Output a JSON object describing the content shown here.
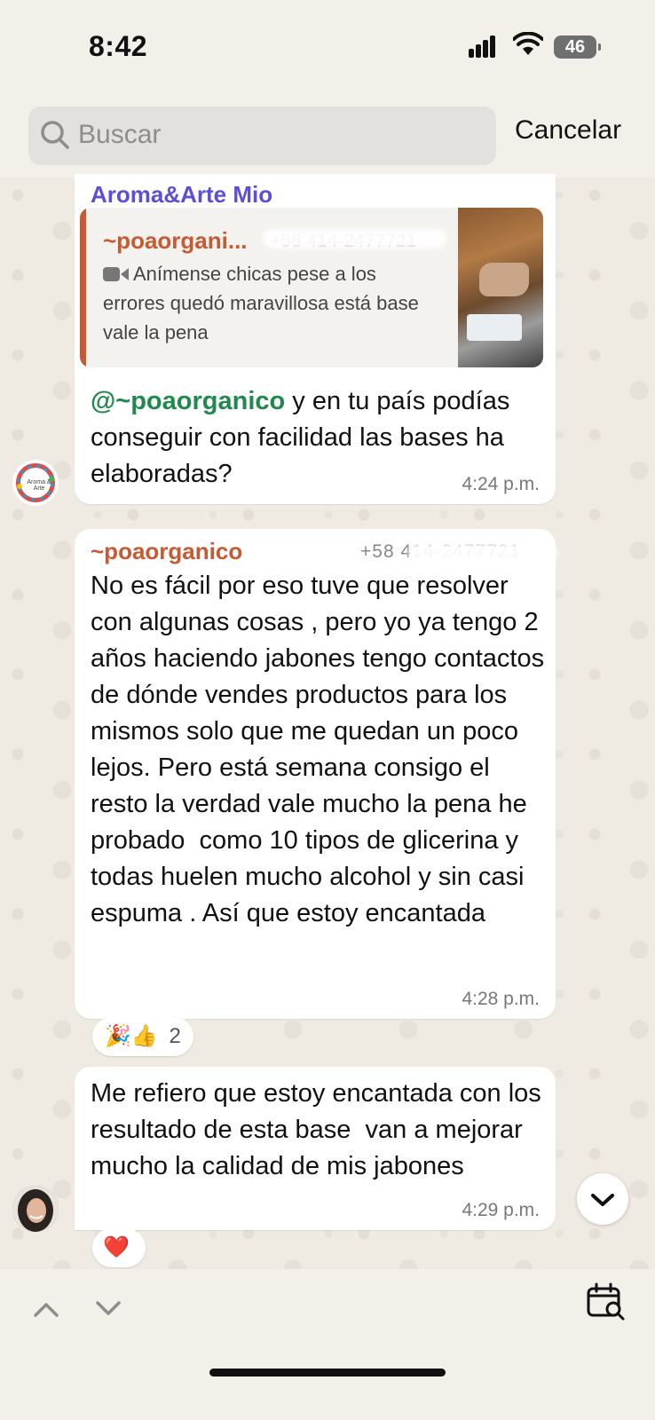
{
  "status_bar": {
    "time": "8:42",
    "battery": "46"
  },
  "search": {
    "placeholder": "Buscar",
    "value": "",
    "cancel_label": "Cancelar"
  },
  "messages": [
    {
      "sender": "Aroma&Arte Mio",
      "quote": {
        "sender": "~poaorgani...",
        "phone": "+58 414-2477721",
        "text": "Anímense chicas pese a los errores quedó maravillosa está base vale la pena"
      },
      "mention": "@~poaorganico",
      "text": " y en tu país podías conseguir con facilidad las bases ha elaboradas?",
      "time": "4:24 p.m.",
      "avatar_label": "Aroma & Arte"
    },
    {
      "sender": "~poaorganico",
      "phone": "+58 414-2477721",
      "text": "No es fácil por eso tuve que resolver con algunas cosas , pero yo ya tengo 2 años haciendo jabones tengo contactos de dónde vendes productos para los mismos solo que me quedan un poco lejos. Pero está semana consigo el resto la verdad vale mucho la pena he probado  como 10 tipos de glicerina y todas huelen mucho alcohol y sin casi espuma . Así que estoy encantada",
      "time": "4:28 p.m.",
      "reactions": {
        "emojis": "🎉👍",
        "count": "2"
      }
    },
    {
      "text": "Me refiero que estoy encantada con los resultado de esta base  van a mejorar mucho la calidad de mis jabones",
      "time": "4:29 p.m.",
      "reactions": {
        "emojis": "❤️"
      }
    }
  ],
  "colors": {
    "sender_group": "#5b4fd6",
    "sender_member": "#c75a32",
    "mention": "#1f8a4c",
    "background": "#efeae2"
  }
}
